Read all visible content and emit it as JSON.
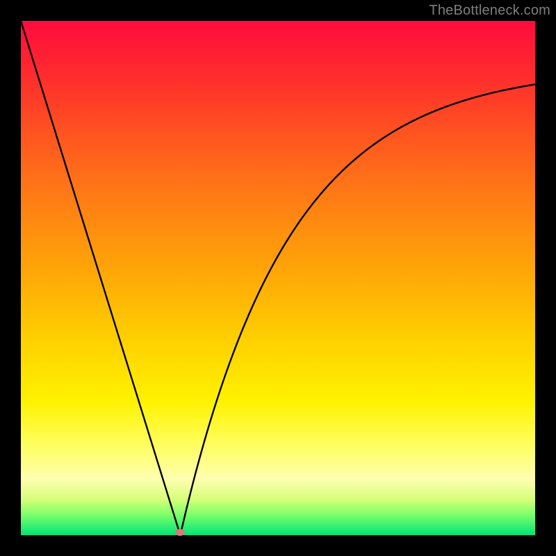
{
  "watermark": "TheBottleneck.com",
  "chart_data": {
    "type": "line",
    "title": "",
    "xlabel": "",
    "ylabel": "",
    "x": [
      0.0,
      0.05,
      0.1,
      0.15,
      0.2,
      0.25,
      0.3,
      0.35,
      0.4,
      0.45,
      0.5,
      0.55,
      0.6,
      0.65,
      0.7,
      0.75,
      0.8,
      0.85,
      0.9,
      0.95,
      1.0
    ],
    "values": [
      1.0,
      0.84,
      0.68,
      0.52,
      0.36,
      0.2,
      0.04,
      0.12,
      0.29,
      0.44,
      0.56,
      0.66,
      0.73,
      0.79,
      0.83,
      0.86,
      0.88,
      0.89,
      0.9,
      0.9,
      0.91
    ],
    "xlim": [
      0,
      1
    ],
    "ylim": [
      0,
      1
    ],
    "minimum": {
      "x": 0.31,
      "y": 0.0
    },
    "notes": "V-shaped curve on a red-to-green vertical gradient background; x/y are normalized axis fractions (no tick labels shown)."
  },
  "colors": {
    "curve": "#000000",
    "marker": "#d97a78",
    "frame": "#000000"
  }
}
